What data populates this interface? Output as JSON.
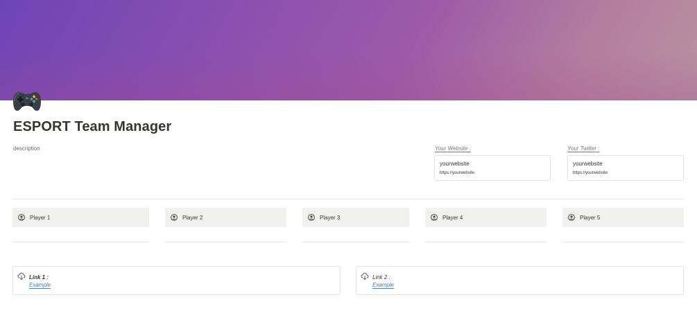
{
  "page": {
    "title": "ESPORT Team Manager",
    "description": "description",
    "icon": "gamepad-icon"
  },
  "properties": {
    "website": {
      "label": "Your Website :",
      "title": "yourwebsite",
      "url": "https://yourwebsite"
    },
    "twitter": {
      "label": "Your Twitter :",
      "title": "yourwebsite",
      "url": "https://yourwebsite"
    }
  },
  "players": [
    {
      "label": "Player 1",
      "icon": "user-circle-icon"
    },
    {
      "label": "Player 2",
      "icon": "user-circle-icon"
    },
    {
      "label": "Player 3",
      "icon": "user-circle-icon"
    },
    {
      "label": "Player 4",
      "icon": "user-circle-icon"
    },
    {
      "label": "Player 5",
      "icon": "user-circle-icon"
    }
  ],
  "links": [
    {
      "title": "Link 1 :",
      "anchor": "Example",
      "icon": "cloud-download-icon"
    },
    {
      "title": "Link 2 :",
      "anchor": "Example",
      "icon": "cloud-download-icon"
    }
  ],
  "colors": {
    "cover_start": "#6e45b5",
    "cover_end": "#b892a3",
    "card_bg": "#f1f1ef",
    "link": "#3e7fcb",
    "text": "#37352f"
  }
}
